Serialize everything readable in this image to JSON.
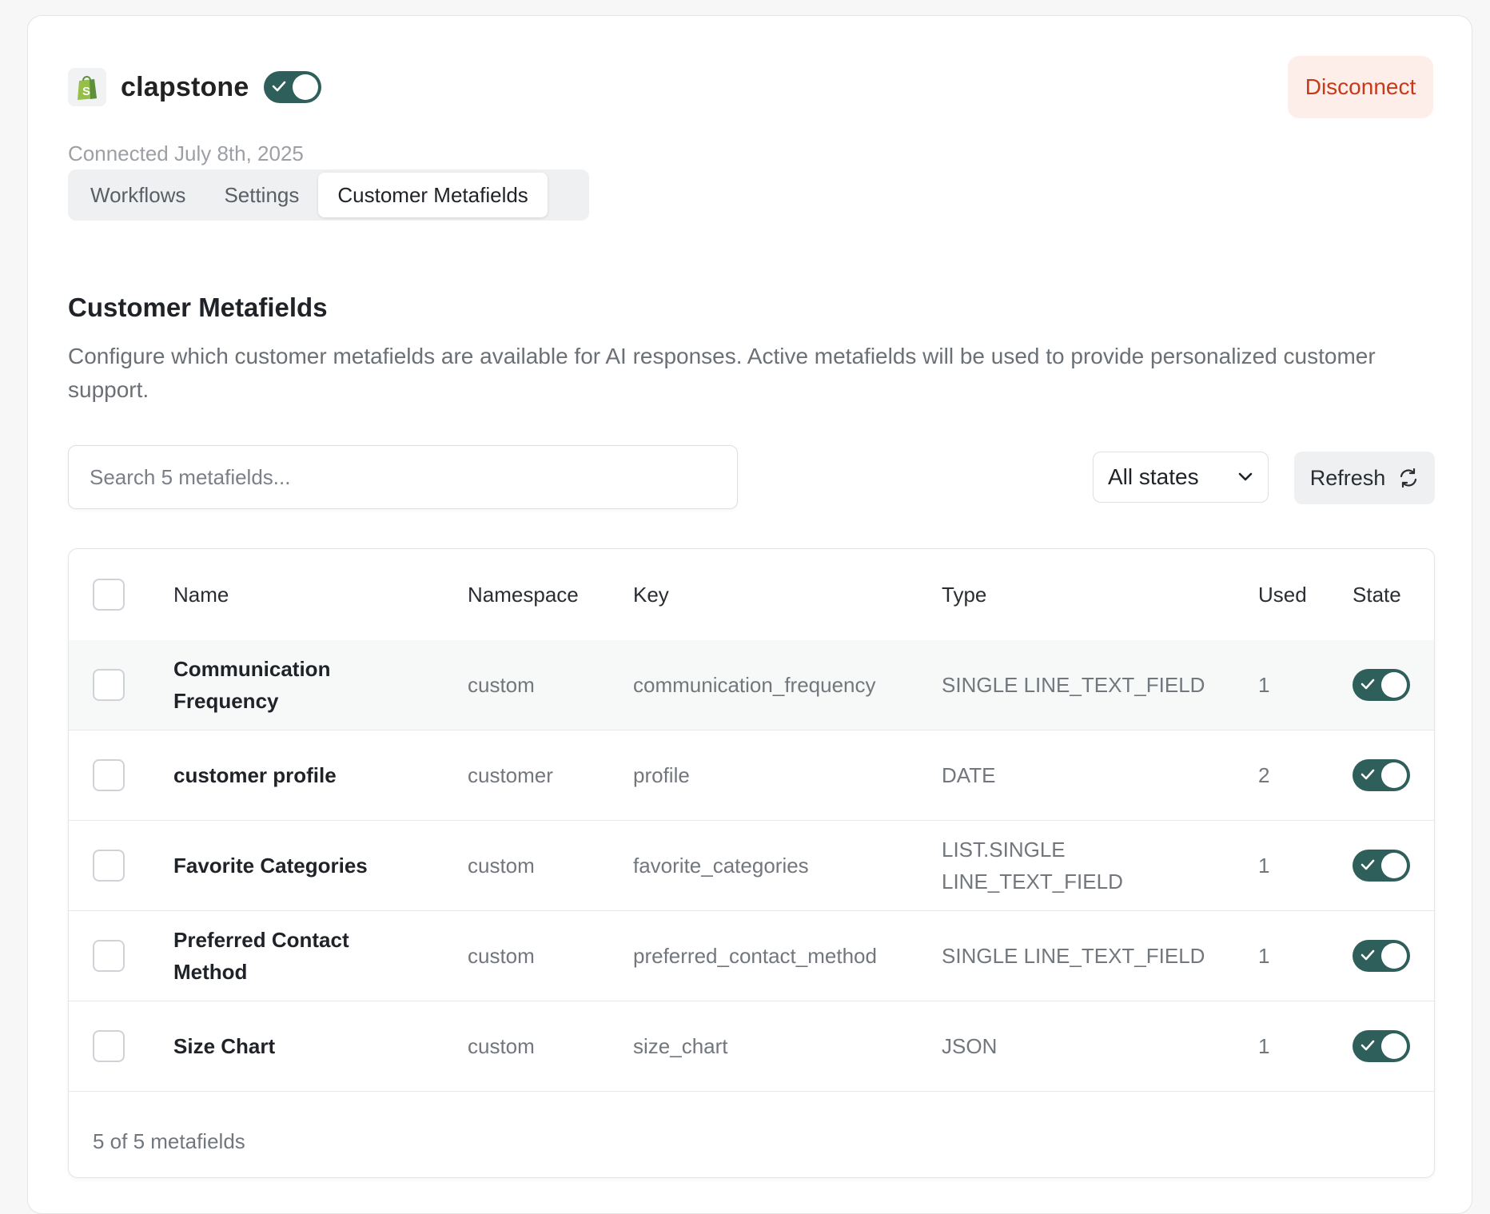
{
  "store": {
    "name": "clapstone",
    "connected_label": "Connected July 8th, 2025",
    "enabled": true
  },
  "header": {
    "disconnect_label": "Disconnect"
  },
  "tabs": [
    {
      "label": "Workflows",
      "active": false
    },
    {
      "label": "Settings",
      "active": false
    },
    {
      "label": "Customer Metafields",
      "active": true
    }
  ],
  "section": {
    "title": "Customer Metafields",
    "description": "Configure which customer metafields are available for AI responses. Active metafields will be used to provide personalized customer support."
  },
  "toolbar": {
    "search_placeholder": "Search 5 metafields...",
    "states_value": "All states",
    "refresh_label": "Refresh"
  },
  "table": {
    "columns": [
      "Name",
      "Namespace",
      "Key",
      "Type",
      "Used",
      "State"
    ],
    "rows": [
      {
        "name": "Communication Frequency",
        "namespace": "custom",
        "key": "communication_frequency",
        "type": "SINGLE LINE_TEXT_FIELD",
        "used": "1",
        "active": true
      },
      {
        "name": "customer profile",
        "namespace": "customer",
        "key": "profile",
        "type": "DATE",
        "used": "2",
        "active": true
      },
      {
        "name": "Favorite Categories",
        "namespace": "custom",
        "key": "favorite_categories",
        "type": "LIST.SINGLE LINE_TEXT_FIELD",
        "used": "1",
        "active": true
      },
      {
        "name": "Preferred Contact Method",
        "namespace": "custom",
        "key": "preferred_contact_method",
        "type": "SINGLE LINE_TEXT_FIELD",
        "used": "1",
        "active": true
      },
      {
        "name": "Size Chart",
        "namespace": "custom",
        "key": "size_chart",
        "type": "JSON",
        "used": "1",
        "active": true
      }
    ],
    "footer": "5 of 5 metafields"
  },
  "colors": {
    "accent": "#2e5f5a",
    "danger": "#c8391c",
    "danger_bg": "#fdeeea",
    "shopify_green": "#95bf47"
  },
  "icons": [
    "shopify-bag-icon",
    "check-icon",
    "chevron-down-icon",
    "refresh-icon"
  ]
}
